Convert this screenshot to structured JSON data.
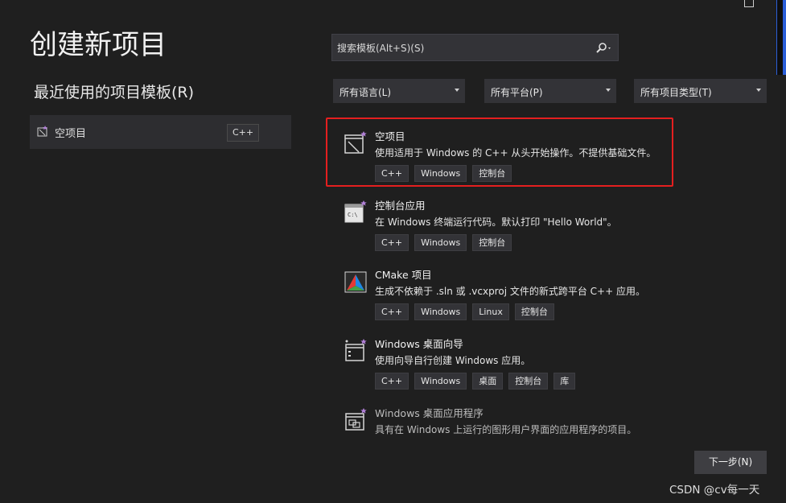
{
  "window": {
    "title": "创建新项目"
  },
  "recent": {
    "title": "最近使用的项目模板(R)",
    "items": [
      {
        "name": "空项目",
        "tag": "C++"
      }
    ]
  },
  "search": {
    "placeholder": "搜索模板(Alt+S)(S)",
    "icon": "search-icon"
  },
  "filters": {
    "language": "所有语言(L)",
    "platform": "所有平台(P)",
    "project_type": "所有项目类型(T)"
  },
  "templates": [
    {
      "name": "空项目",
      "description": "使用适用于 Windows 的 C++ 从头开始操作。不提供基础文件。",
      "tags": [
        "C++",
        "Windows",
        "控制台"
      ],
      "icon": "empty-project-icon",
      "selected": true
    },
    {
      "name": "控制台应用",
      "description": "在 Windows 终端运行代码。默认打印 \"Hello World\"。",
      "tags": [
        "C++",
        "Windows",
        "控制台"
      ],
      "icon": "console-app-icon"
    },
    {
      "name": "CMake 项目",
      "description": "生成不依赖于 .sln 或 .vcxproj 文件的新式跨平台 C++ 应用。",
      "tags": [
        "C++",
        "Windows",
        "Linux",
        "控制台"
      ],
      "icon": "cmake-icon"
    },
    {
      "name": "Windows 桌面向导",
      "description": "使用向导自行创建 Windows 应用。",
      "tags": [
        "C++",
        "Windows",
        "桌面",
        "控制台",
        "库"
      ],
      "icon": "desktop-wizard-icon"
    },
    {
      "name": "Windows 桌面应用程序",
      "description": "具有在 Windows 上运行的图形用户界面的应用程序的项目。",
      "tags": [],
      "icon": "desktop-app-icon"
    }
  ],
  "footer": {
    "next_label": "下一步(N)",
    "watermark": "CSDN @cv每一天"
  },
  "colors": {
    "background": "#1f1f1f",
    "highlight": "#e41f1f",
    "accent": "#2b5fd9"
  }
}
